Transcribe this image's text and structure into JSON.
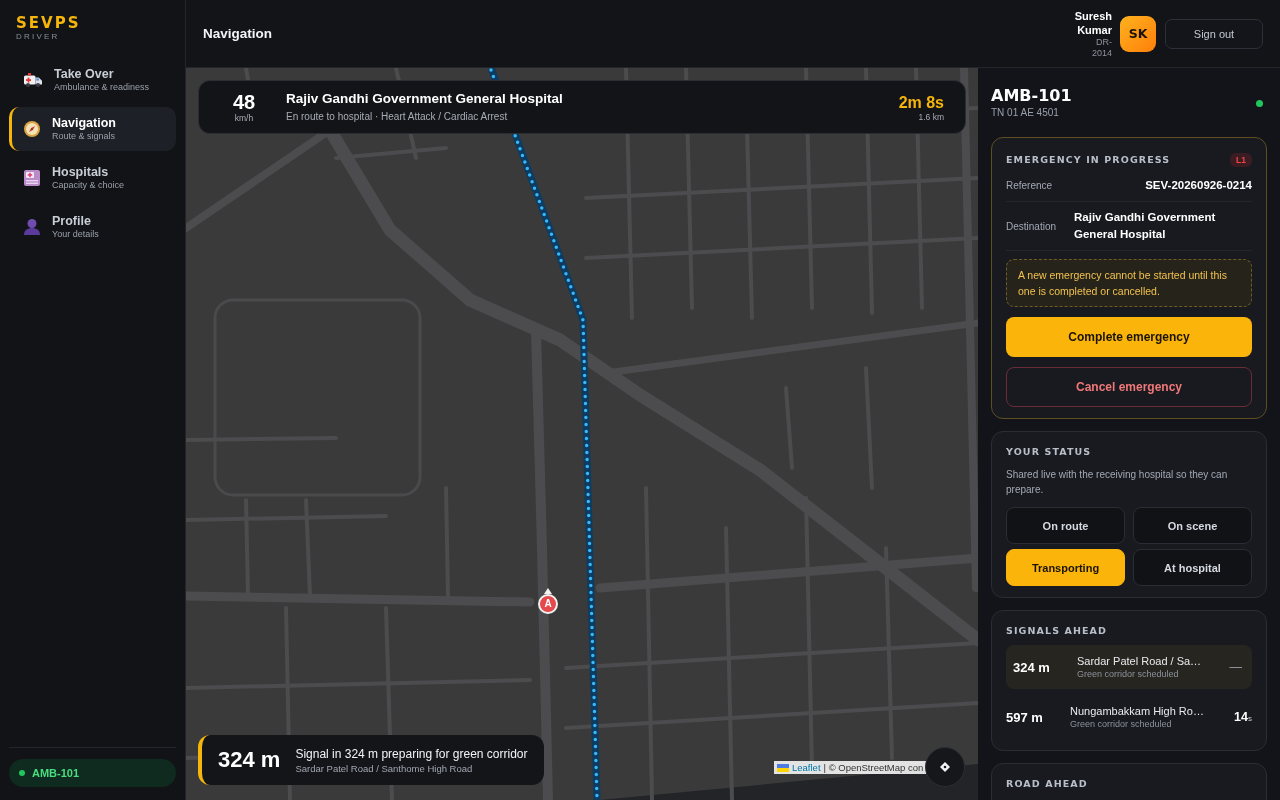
{
  "sidebar": {
    "logo": {
      "title": "SEVPS",
      "subtitle": "DRIVER"
    },
    "items": [
      {
        "kind": "ambulance",
        "label": "Take Over",
        "sublabel": "Ambulance & readiness",
        "selected": false
      },
      {
        "kind": "compass",
        "label": "Navigation",
        "sublabel": "Route & signals",
        "selected": true
      },
      {
        "kind": "hospital",
        "label": "Hospitals",
        "sublabel": "Capacity & choice",
        "selected": false
      },
      {
        "kind": "person",
        "label": "Profile",
        "sublabel": "Your details",
        "selected": false
      }
    ],
    "vehicle_pill": {
      "label": "AMB-101",
      "online": true
    }
  },
  "top_bar": {
    "title": "Navigation",
    "user": {
      "name": "Suresh Kumar",
      "id": "DR-2014",
      "initials": "SK"
    },
    "sign_out": "Sign out"
  },
  "map": {
    "trip_card": {
      "speed": "48",
      "speed_unit": "km/h",
      "destination": "Rajiv Gandhi Government General Hospital",
      "subtitle": "En route to hospital · Heart Attack / Cardiac Arrest",
      "eta": "2m 8s",
      "distance": "1.6 km"
    },
    "marker": {
      "label": "A"
    },
    "signal_card": {
      "distance": "324 m",
      "message": "Signal in 324 m preparing for green corridor",
      "road": "Sardar Patel Road / Santhome High Road"
    },
    "attribution": {
      "link": "Leaflet",
      "text": "| © OpenStreetMap con"
    }
  },
  "panel": {
    "vehicle": {
      "id": "AMB-101",
      "plate": "TN 01 AE 4501",
      "online": true
    },
    "emergency": {
      "title": "EMERGENCY IN PROGRESS",
      "badge": "L1",
      "fields": [
        {
          "label": "Reference",
          "value": "SEV-20260926-0214"
        },
        {
          "label": "Destination",
          "value": "Rajiv Gandhi Government General Hospital"
        }
      ],
      "notice": "A new emergency cannot be started until this one is completed or cancelled.",
      "actions": [
        {
          "kind": "primary",
          "label": "Complete emergency"
        },
        {
          "kind": "danger",
          "label": "Cancel emergency"
        }
      ]
    },
    "status": {
      "title": "YOUR STATUS",
      "description": "Shared live with the receiving hospital so they can prepare.",
      "options": [
        {
          "label": "On route",
          "selected": false
        },
        {
          "label": "On scene",
          "selected": false
        },
        {
          "label": "Transporting",
          "selected": true
        },
        {
          "label": "At hospital",
          "selected": false
        }
      ]
    },
    "signals": {
      "title": "SIGNALS AHEAD",
      "rows": [
        {
          "distance": "324 m",
          "name": "Sardar Patel Road / Sa…",
          "note": "Green corridor scheduled",
          "countdown": "—",
          "current": true
        },
        {
          "distance": "597 m",
          "name": "Nungambakkam High Ro…",
          "note": "Green corridor scheduled",
          "countdown": "14",
          "unit": "s",
          "current": false
        }
      ]
    },
    "road_ahead": {
      "title": "ROAD AHEAD"
    }
  }
}
